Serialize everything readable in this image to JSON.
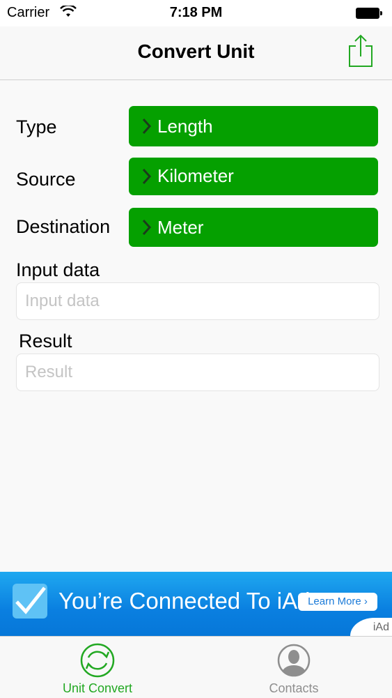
{
  "status_bar": {
    "carrier": "Carrier",
    "time": "7:18 PM"
  },
  "navbar": {
    "title": "Convert Unit",
    "share_icon": "share-icon"
  },
  "form": {
    "type": {
      "label": "Type",
      "value": "Length"
    },
    "source": {
      "label": "Source",
      "value": "Kilometer"
    },
    "destination": {
      "label": "Destination",
      "value": "Meter"
    },
    "input": {
      "label": "Input data",
      "placeholder": "Input data"
    },
    "result": {
      "label": "Result",
      "placeholder": "Result"
    }
  },
  "ad": {
    "headline": "You’re Connected To iAd",
    "button": "Learn More ›",
    "badge": "iAd"
  },
  "tabs": [
    {
      "label": "Unit Convert",
      "icon": "refresh-circle-icon",
      "active": true
    },
    {
      "label": "Contacts",
      "icon": "contact-person-icon",
      "active": false
    }
  ],
  "colors": {
    "accent_green": "#05a000",
    "tab_green": "#22a822",
    "ad_blue": "#0a7fe0"
  }
}
